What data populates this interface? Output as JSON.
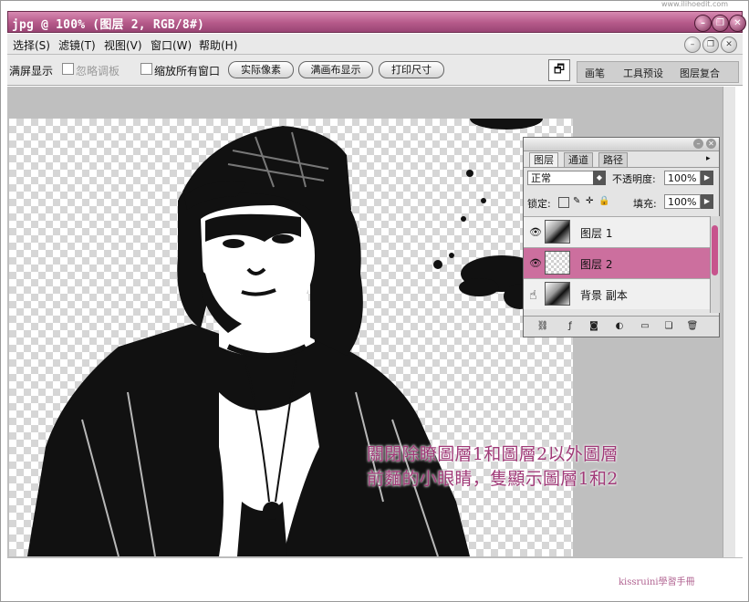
{
  "window": {
    "title": "jpg @ 100% (图层 2, RGB/8#)",
    "top_watermark": "www.ilihoedit.com"
  },
  "menu": {
    "items": [
      "选择(S)",
      "滤镜(T)",
      "视图(V)",
      "窗口(W)",
      "帮助(H)"
    ]
  },
  "options_bar": {
    "fit_screen": "满屏显示",
    "ignore_palettes": "忽略调板",
    "zoom_all_windows": "缩放所有窗口",
    "actual_pixels_button": "实际像素",
    "fit_on_screen_button": "满画布显示",
    "print_size_button": "打印尺寸"
  },
  "palette_well": {
    "tabs": [
      "画笔",
      "工具预设",
      "图层复合"
    ]
  },
  "layers_panel": {
    "tabs": [
      "图层",
      "通道",
      "路径"
    ],
    "blend_mode": "正常",
    "opacity_label": "不透明度:",
    "opacity_value": "100%",
    "lock_label": "锁定:",
    "fill_label": "填充:",
    "fill_value": "100%",
    "layers": [
      {
        "name": "图层 1",
        "visible": true,
        "selected": false
      },
      {
        "name": "图层 2",
        "visible": true,
        "selected": true
      },
      {
        "name": "背景 副本",
        "visible": false,
        "selected": false
      }
    ]
  },
  "caption": {
    "line1": "關閉除瞭圖層1和圖層2以外圖層",
    "line2": "前麵的小眼睛，隻顯示圖層1和2"
  },
  "watermark": "kissruini學習手冊",
  "colors": {
    "accent": "#b55a8a",
    "selected_layer": "#cc6f9e",
    "caption": "#a03a78"
  }
}
